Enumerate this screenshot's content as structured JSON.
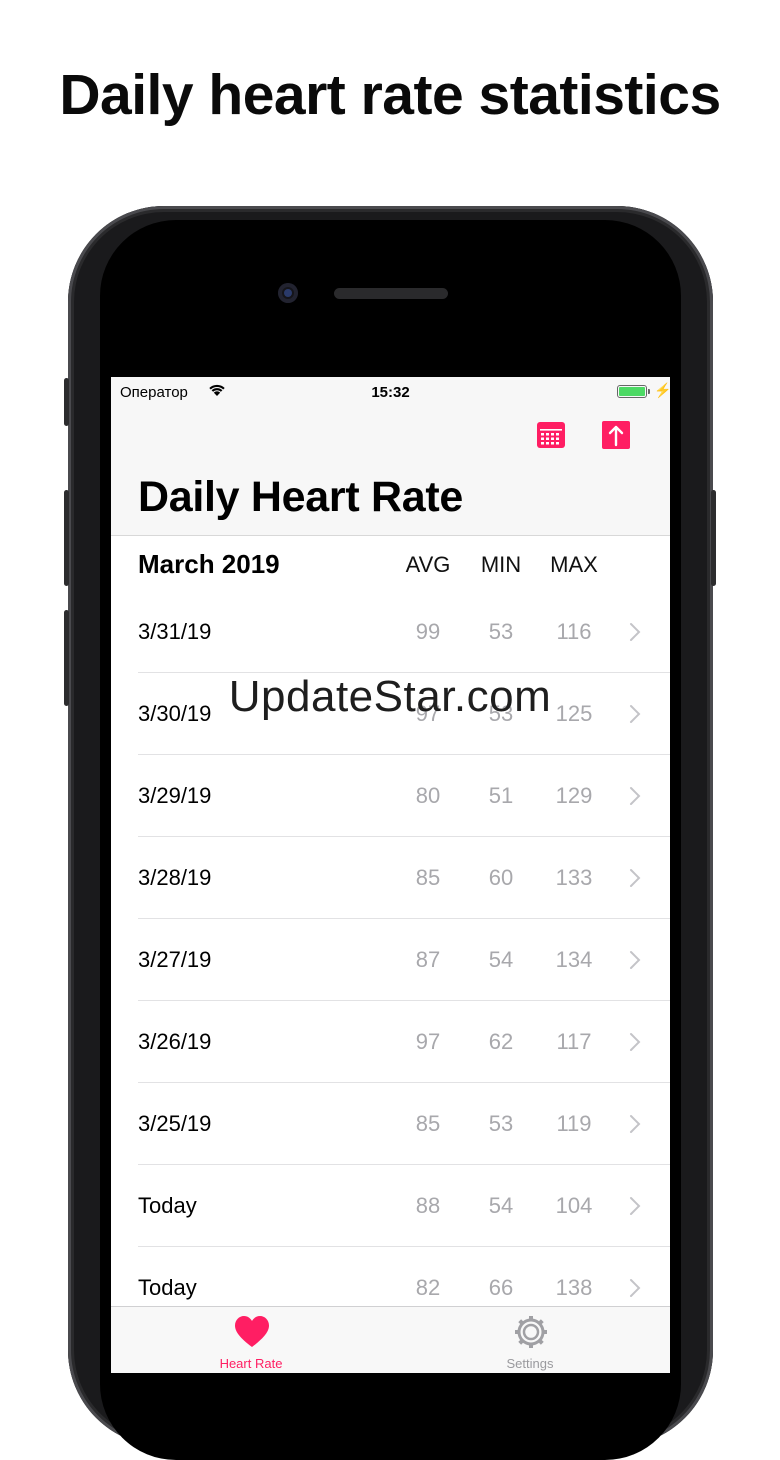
{
  "promo": {
    "title": "Daily heart rate statistics"
  },
  "status_bar": {
    "carrier": "Оператор",
    "time": "15:32"
  },
  "nav": {
    "title": "Daily Heart Rate",
    "accent_color": "#ff1e63"
  },
  "table": {
    "month": "March 2019",
    "columns": [
      "AVG",
      "MIN",
      "MAX"
    ],
    "rows": [
      {
        "date": "3/31/19",
        "avg": "99",
        "min": "53",
        "max": "116"
      },
      {
        "date": "3/30/19",
        "avg": "97",
        "min": "53",
        "max": "125"
      },
      {
        "date": "3/29/19",
        "avg": "80",
        "min": "51",
        "max": "129"
      },
      {
        "date": "3/28/19",
        "avg": "85",
        "min": "60",
        "max": "133"
      },
      {
        "date": "3/27/19",
        "avg": "87",
        "min": "54",
        "max": "134"
      },
      {
        "date": "3/26/19",
        "avg": "97",
        "min": "62",
        "max": "117"
      },
      {
        "date": "3/25/19",
        "avg": "85",
        "min": "53",
        "max": "119"
      },
      {
        "date": "Today",
        "avg": "88",
        "min": "54",
        "max": "104"
      },
      {
        "date": "Today",
        "avg": "82",
        "min": "66",
        "max": "138"
      }
    ]
  },
  "tabs": [
    {
      "label": "Heart Rate",
      "icon": "heart-icon",
      "active": true
    },
    {
      "label": "Settings",
      "icon": "gear-icon",
      "active": false
    }
  ],
  "watermark": "UpdateStar.com"
}
